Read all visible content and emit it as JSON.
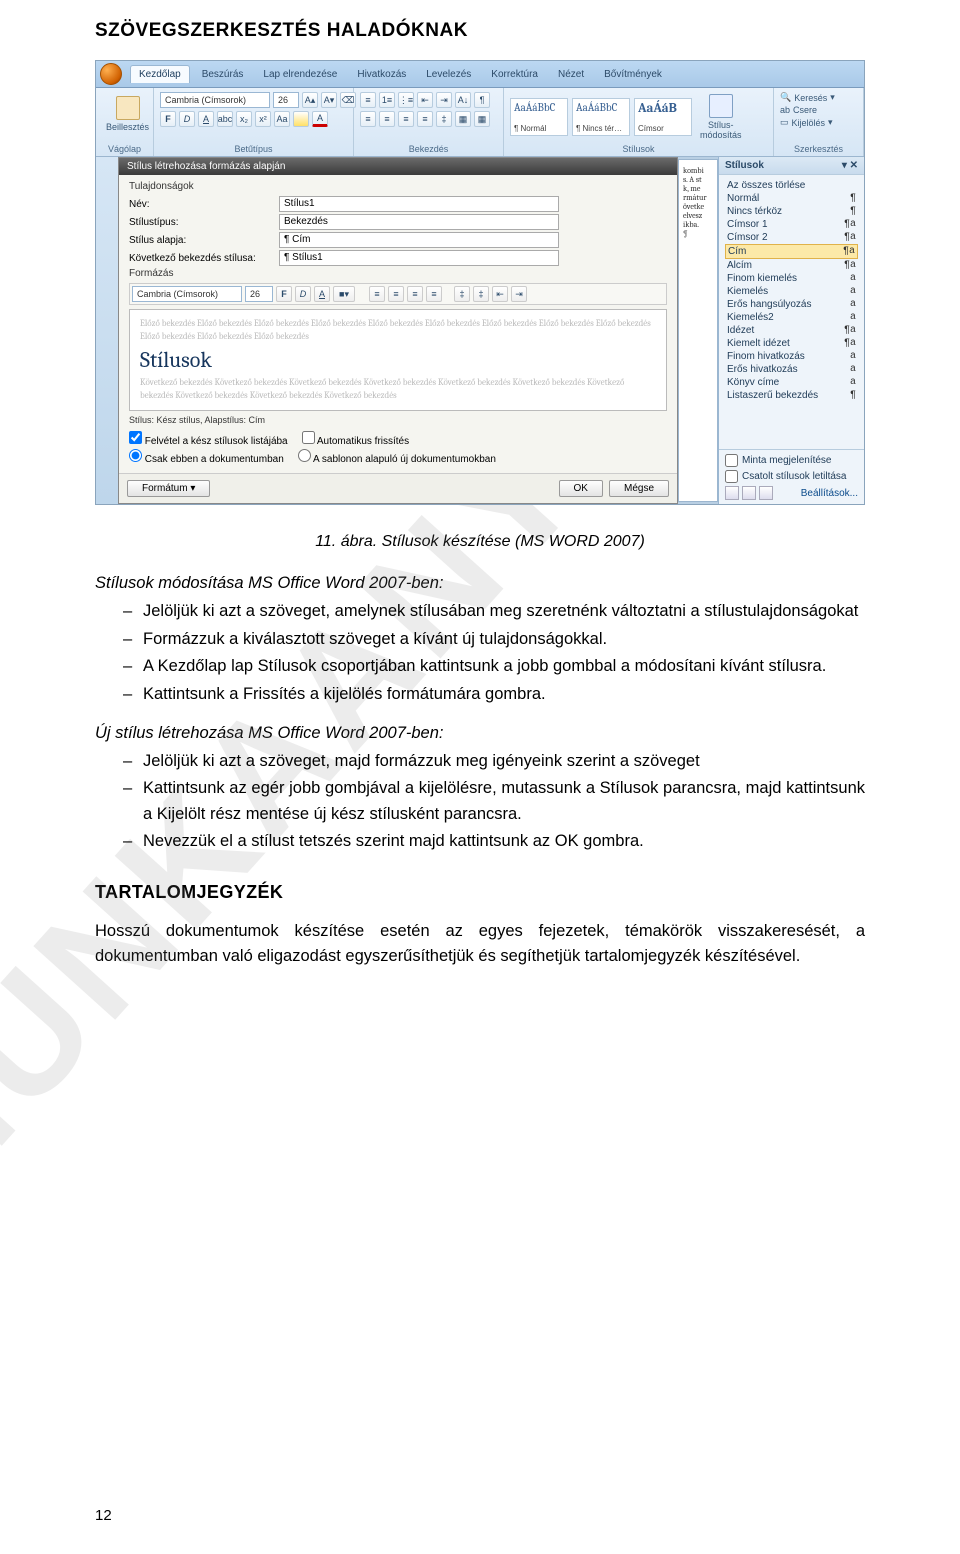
{
  "header": {
    "title": "SZÖVEGSZERKESZTÉS HALADÓKNAK"
  },
  "watermark": "MUNKAANYAG",
  "caption": "11. ábra. Stílusok készítése (MS WORD 2007)",
  "section1": {
    "title": "Stílusok módosítása MS Office Word 2007-ben:",
    "items": [
      "Jelöljük ki azt a szöveget, amelynek stílusában meg szeretnénk változtatni a stílustulajdonságokat",
      "Formázzuk a kiválasztott szöveget a kívánt új tulajdonságokkal.",
      "A Kezdőlap lap Stílusok csoportjában kattintsunk a jobb gombbal a módosítani kívánt stílusra.",
      "Kattintsunk a Frissítés a kijelölés formátumára gombra."
    ]
  },
  "section2": {
    "title": "Új stílus létrehozása MS Office Word 2007-ben:",
    "items": [
      "Jelöljük ki azt a szöveget, majd formázzuk meg igényeink szerint a szöveget",
      "Kattintsunk az egér jobb gombjával a kijelölésre, mutassunk a Stílusok parancsra, majd kattintsunk a Kijelölt rész mentése új kész stílusként parancsra.",
      "Nevezzük el a stílust tetszés szerint majd kattintsunk az OK gombra."
    ]
  },
  "toc": {
    "heading": "TARTALOMJEGYZÉK",
    "para": "Hosszú dokumentumok készítése esetén az egyes fejezetek, témakörök visszakeresését, a dokumentumban való eligazodást egyszerűsíthetjük és segíthetjük tartalomjegyzék készítésével."
  },
  "page_number": "12",
  "screenshot": {
    "ribbon_tabs": [
      "Kezdőlap",
      "Beszúrás",
      "Lap elrendezése",
      "Hivatkozás",
      "Levelezés",
      "Korrektúra",
      "Nézet",
      "Bővítmények"
    ],
    "clipboard": {
      "paste": "Beillesztés",
      "group": "Vágólap"
    },
    "font": {
      "family": "Cambria (Címsorok)",
      "size": "26",
      "buttons": [
        "F",
        "D",
        "A",
        "abc",
        "x₂",
        "x²",
        "Aa"
      ],
      "group": "Betűtípus"
    },
    "paragraph": {
      "group": "Bekezdés"
    },
    "styles": {
      "tiles": [
        {
          "sample": "AaÁáBbC",
          "label": "¶ Normál"
        },
        {
          "sample": "AaÁáBbC",
          "label": "¶ Nincs tér…"
        },
        {
          "sample": "AaÁáB",
          "label": "Címsor"
        }
      ],
      "change_button": "Stílus-\nmódosítás",
      "group": "Stílusok"
    },
    "editing": {
      "find": "Keresés",
      "replace": "Csere",
      "select": "Kijelölés",
      "group": "Szerkesztés"
    },
    "dialog": {
      "title": "Stílus létrehozása formázás alapján",
      "section_props": "Tulajdonságok",
      "name_lbl": "Név:",
      "name_val": "Stílus1",
      "type_lbl": "Stílustípus:",
      "type_val": "Bekezdés",
      "base_lbl": "Stílus alapja:",
      "base_val": "¶ Cím",
      "next_lbl": "Következő bekezdés stílusa:",
      "next_val": "¶ Stílus1",
      "section_format": "Formázás",
      "format_font": "Cambria (Címsorok)",
      "format_size": "26",
      "format_btns": [
        "F",
        "D",
        "A"
      ],
      "preview_faded_before": "Előző bekezdés Előző bekezdés Előző bekezdés Előző bekezdés Előző bekezdés Előző bekezdés Előző bekezdés Előző bekezdés Előző bekezdés Előző bekezdés Előző bekezdés Előző bekezdés",
      "preview_text": "Stílusok",
      "preview_faded_after": "Következő bekezdés Következő bekezdés Következő bekezdés Következő bekezdés Következő bekezdés Következő bekezdés Következő bekezdés Következő bekezdés Következő bekezdés Következő bekezdés",
      "status": "Stílus: Kész stílus, Alapstílus: Cím",
      "opt_add": "Felvétel a kész stílusok listájába",
      "opt_auto": "Automatikus frissítés",
      "opt_thisdoc": "Csak ebben a dokumentumban",
      "opt_template": "A sablonon alapuló új dokumentumokban",
      "format_btn": "Formátum ▾",
      "ok": "OK",
      "cancel": "Mégse"
    },
    "paper_words": [
      "kombi",
      "s. A st",
      "k, me",
      "rmátur",
      "övetke",
      "elvesz",
      "ikba.",
      "¶"
    ],
    "pane": {
      "title": "Stílusok",
      "clear": "Az összes törlése",
      "items": [
        {
          "name": "Normál",
          "mark": "¶"
        },
        {
          "name": "Nincs térköz",
          "mark": "¶"
        },
        {
          "name": "Címsor 1",
          "mark": "¶a"
        },
        {
          "name": "Címsor 2",
          "mark": "¶a"
        },
        {
          "name": "Cím",
          "mark": "¶a",
          "selected": true
        },
        {
          "name": "Alcím",
          "mark": "¶a"
        },
        {
          "name": "Finom kiemelés",
          "mark": "a"
        },
        {
          "name": "Kiemelés",
          "mark": "a"
        },
        {
          "name": "Erős hangsúlyozás",
          "mark": "a"
        },
        {
          "name": "Kiemelés2",
          "mark": "a"
        },
        {
          "name": "Idézet",
          "mark": "¶a"
        },
        {
          "name": "Kiemelt idézet",
          "mark": "¶a"
        },
        {
          "name": "Finom hivatkozás",
          "mark": "a"
        },
        {
          "name": "Erős hivatkozás",
          "mark": "a"
        },
        {
          "name": "Könyv címe",
          "mark": "a"
        },
        {
          "name": "Listaszerű bekezdés",
          "mark": "¶"
        }
      ],
      "chk_preview": "Minta megjelenítése",
      "chk_linked": "Csatolt stílusok letiltása",
      "settings": "Beállítások..."
    }
  }
}
